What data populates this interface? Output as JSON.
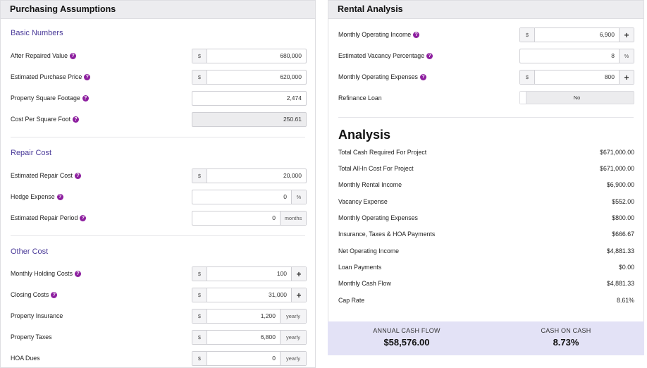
{
  "left": {
    "title": "Purchasing Assumptions",
    "basic": {
      "title": "Basic Numbers",
      "after_repaired": {
        "label": "After Repaired Value",
        "prefix": "$",
        "value": "680,000"
      },
      "purchase_price": {
        "label": "Estimated Purchase Price",
        "prefix": "$",
        "value": "620,000"
      },
      "square_footage": {
        "label": "Property Square Footage",
        "value": "2,474"
      },
      "cost_per_sqft": {
        "label": "Cost Per Square Foot",
        "value": "250.61"
      }
    },
    "repair": {
      "title": "Repair Cost",
      "repair_cost": {
        "label": "Estimated Repair Cost",
        "prefix": "$",
        "value": "20,000"
      },
      "hedge_expense": {
        "label": "Hedge Expense",
        "value": "0",
        "suffix": "%"
      },
      "repair_period": {
        "label": "Estimated Repair Period",
        "value": "0",
        "suffix": "months"
      }
    },
    "other": {
      "title": "Other Cost",
      "holding": {
        "label": "Monthly Holding Costs",
        "prefix": "$",
        "value": "100",
        "action": "+"
      },
      "closing": {
        "label": "Closing Costs",
        "prefix": "$",
        "value": "31,000",
        "action": "+"
      },
      "insurance": {
        "label": "Property Insurance",
        "prefix": "$",
        "value": "1,200",
        "suffix": "yearly"
      },
      "taxes": {
        "label": "Property Taxes",
        "prefix": "$",
        "value": "6,800",
        "suffix": "yearly"
      },
      "hoa": {
        "label": "HOA Dues",
        "prefix": "$",
        "value": "0",
        "suffix": "yearly"
      }
    }
  },
  "right": {
    "title": "Rental Analysis",
    "operating_income": {
      "label": "Monthly Operating Income",
      "prefix": "$",
      "value": "6,900",
      "action": "+"
    },
    "vacancy_pct": {
      "label": "Estimated Vacancy Percentage",
      "value": "8",
      "suffix": "%"
    },
    "operating_expenses": {
      "label": "Monthly Operating Expenses",
      "prefix": "$",
      "value": "800",
      "action": "+"
    },
    "refinance": {
      "label": "Refinance Loan",
      "value": "No"
    },
    "analysis": {
      "title": "Analysis",
      "rows": [
        {
          "label": "Total Cash Required For Project",
          "value": "$671,000.00"
        },
        {
          "label": "Total All-In Cost For Project",
          "value": "$671,000.00"
        },
        {
          "label": "Monthly Rental Income",
          "value": "$6,900.00"
        },
        {
          "label": "Vacancy Expense",
          "value": "$552.00"
        },
        {
          "label": "Monthly Operating Expenses",
          "value": "$800.00"
        },
        {
          "label": "Insurance, Taxes & HOA Payments",
          "value": "$666.67"
        },
        {
          "label": "Net Operating Income",
          "value": "$4,881.33"
        },
        {
          "label": "Loan Payments",
          "value": "$0.00"
        },
        {
          "label": "Monthly Cash Flow",
          "value": "$4,881.33"
        },
        {
          "label": "Cap Rate",
          "value": "8.61%"
        }
      ]
    },
    "summary": {
      "annual_label": "ANNUAL CASH FLOW",
      "annual_value": "$58,576.00",
      "coc_label": "CASH ON CASH",
      "coc_value": "8.73%"
    }
  },
  "help_glyph": "?",
  "colors": {
    "accent": "#4a3a99",
    "help": "#8d1f9f",
    "summary_bg": "#e3e2f6"
  }
}
